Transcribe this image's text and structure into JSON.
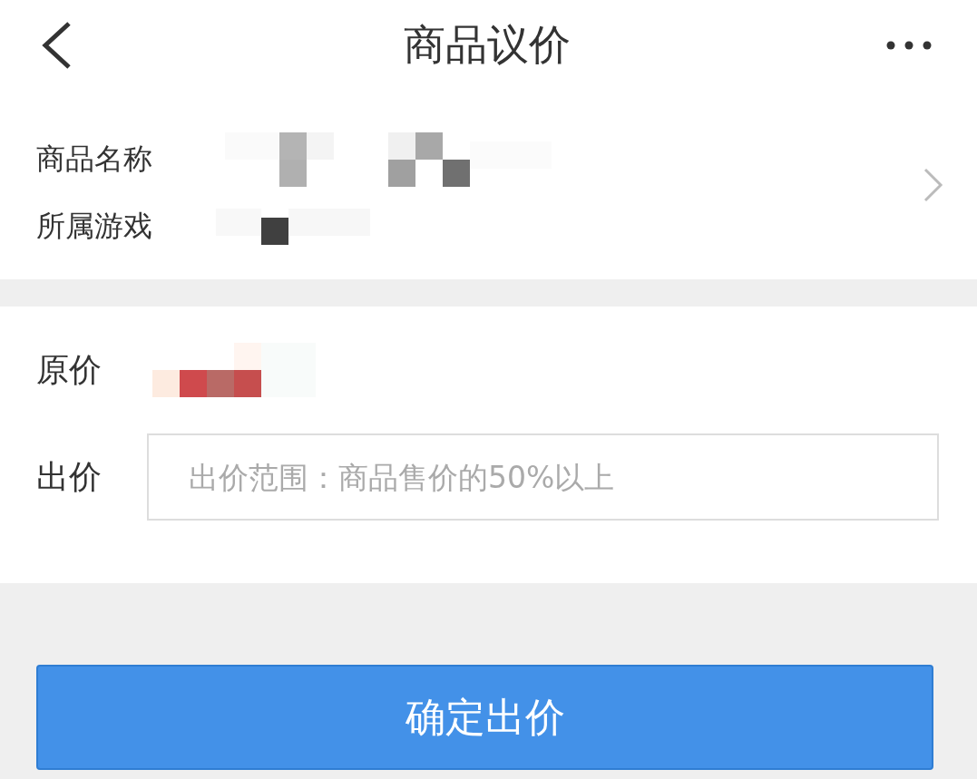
{
  "header": {
    "title": "商品议价"
  },
  "product": {
    "fields": [
      {
        "label": "商品名称"
      },
      {
        "label": "所属游戏"
      }
    ]
  },
  "offer": {
    "original_price_label": "原价",
    "bid_label": "出价",
    "bid_placeholder": "出价范围：商品售价的50%以上"
  },
  "confirm_button": "确定出价"
}
